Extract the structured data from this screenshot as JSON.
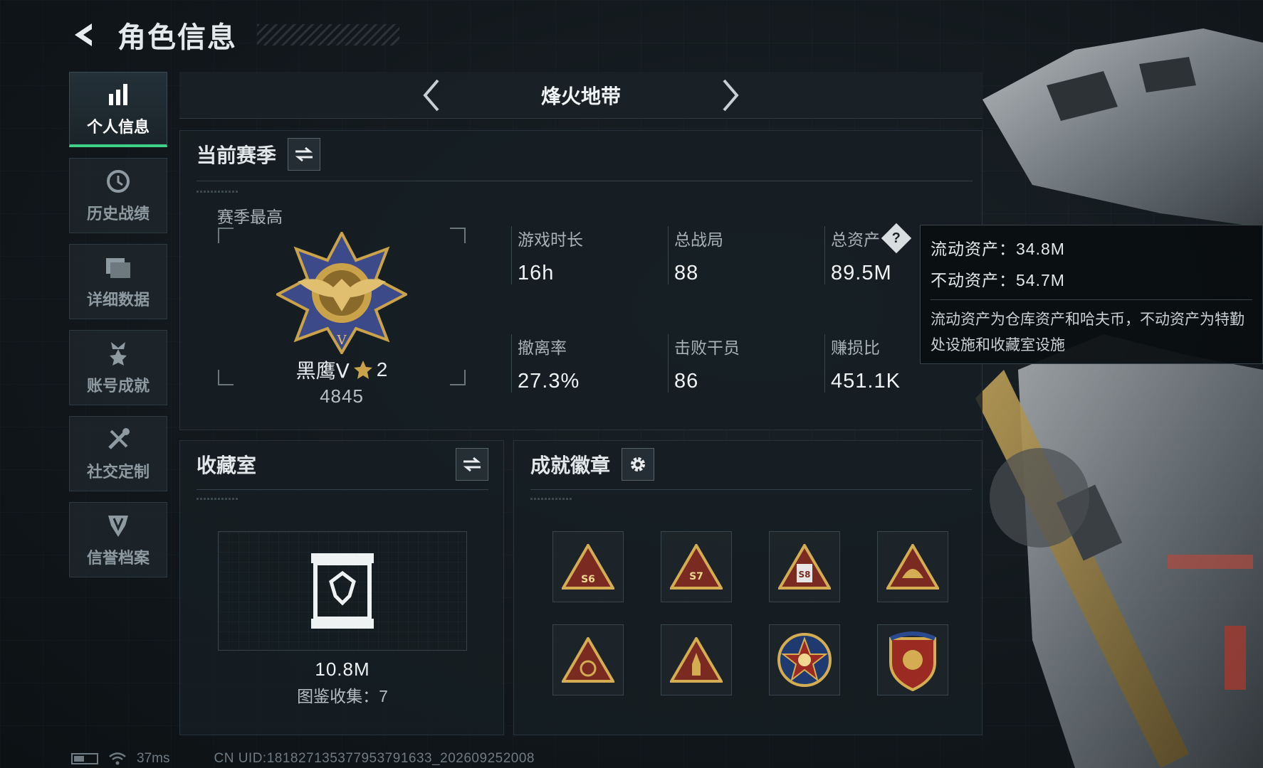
{
  "header": {
    "title": "角色信息"
  },
  "sidebar": {
    "items": [
      {
        "label": "个人信息",
        "icon": "bar-chart-icon",
        "active": true
      },
      {
        "label": "历史战绩",
        "icon": "clock-icon",
        "active": false
      },
      {
        "label": "详细数据",
        "icon": "folder-icon",
        "active": false
      },
      {
        "label": "账号成就",
        "icon": "medal-icon",
        "active": false
      },
      {
        "label": "社交定制",
        "icon": "tools-icon",
        "active": false
      },
      {
        "label": "信誉档案",
        "icon": "shield-icon",
        "active": false
      }
    ]
  },
  "mode": {
    "name": "烽火地带"
  },
  "season": {
    "title": "当前赛季",
    "best_label": "赛季最高",
    "rank_name": "黑鹰Ⅴ",
    "rank_stars": "2",
    "rank_score": "4845",
    "stats": [
      {
        "label": "游戏时长",
        "value": "16h"
      },
      {
        "label": "总战局",
        "value": "88"
      },
      {
        "label": "总资产",
        "value": "89.5M",
        "help": true
      },
      {
        "label": "撤离率",
        "value": "27.3%"
      },
      {
        "label": "击败干员",
        "value": "86"
      },
      {
        "label": "赚损比",
        "value": "451.1K"
      }
    ]
  },
  "tooltip": {
    "liquid": "流动资产：34.8M",
    "fixed": "不动资产：54.7M",
    "description": "流动资产为仓库资产和哈夫币，不动资产为特勤处设施和收藏室设施"
  },
  "collection": {
    "title": "收藏室",
    "value": "10.8M",
    "count_text": "图鉴收集：7"
  },
  "badges": {
    "title": "成就徽章",
    "items": [
      "S6",
      "S7",
      "S8",
      "helmet",
      "emblem",
      "rocket",
      "skull-star",
      "wings-shield"
    ]
  },
  "footer": {
    "ping": "37ms",
    "uid": "CN UID:1818271353779537916​33_202609252008"
  },
  "colors": {
    "accent_green": "#3fd088",
    "gold": "#c9a24a",
    "badge_red": "#8c2a20"
  }
}
